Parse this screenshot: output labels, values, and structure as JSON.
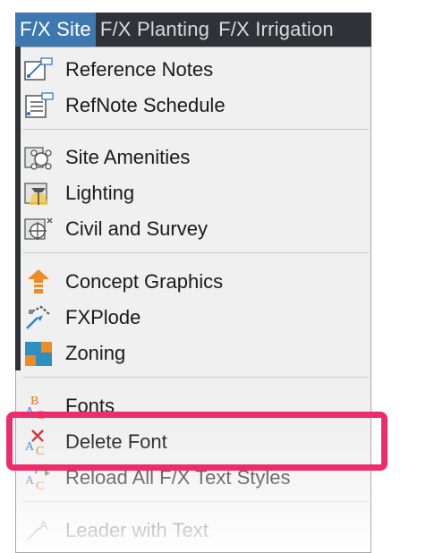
{
  "menubar": {
    "items": [
      {
        "label": "F/X Site"
      },
      {
        "label": "F/X Planting"
      },
      {
        "label": "F/X Irrigation"
      }
    ]
  },
  "menu": {
    "items": [
      {
        "label": "Reference Notes",
        "icon": "reference-notes-icon"
      },
      {
        "label": "RefNote Schedule",
        "icon": "refnote-schedule-icon"
      },
      {
        "label": "Site Amenities",
        "icon": "site-amenities-icon"
      },
      {
        "label": "Lighting",
        "icon": "lighting-icon"
      },
      {
        "label": "Civil and Survey",
        "icon": "civil-survey-icon"
      },
      {
        "label": "Concept Graphics",
        "icon": "concept-graphics-icon"
      },
      {
        "label": "FXPlode",
        "icon": "fxplode-icon"
      },
      {
        "label": "Zoning",
        "icon": "zoning-icon"
      },
      {
        "label": "Fonts",
        "icon": "fonts-icon"
      },
      {
        "label": "Delete Font",
        "icon": "delete-font-icon"
      },
      {
        "label": "Reload All F/X Text Styles",
        "icon": "reload-text-styles-icon"
      },
      {
        "label": "Leader with Text",
        "icon": "leader-with-text-icon"
      }
    ]
  },
  "colors": {
    "menubar_bg": "#2f3337",
    "active_tab": "#3e78b0",
    "menu_bg": "#f0f0f0",
    "highlight": "#ee2c6b"
  }
}
